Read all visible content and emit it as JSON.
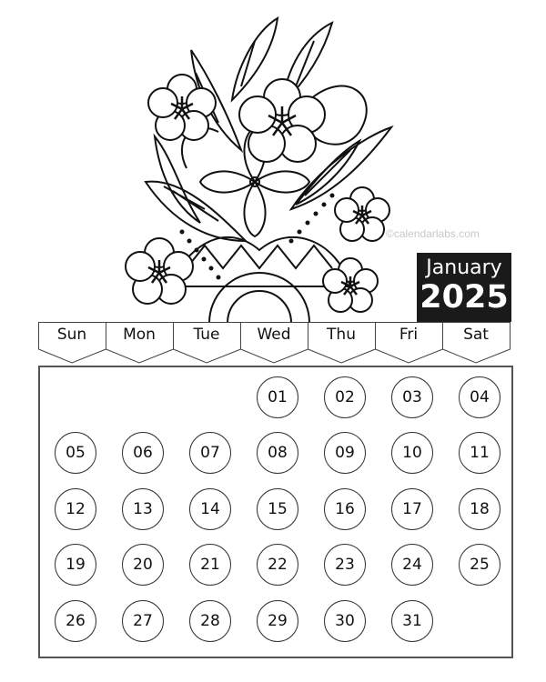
{
  "watermark": "©calendarlabs.com",
  "header": {
    "month": "January",
    "year": "2025"
  },
  "weekdays": [
    "Sun",
    "Mon",
    "Tue",
    "Wed",
    "Thu",
    "Fri",
    "Sat"
  ],
  "calendar": {
    "first_weekday_index": 3,
    "days": [
      "01",
      "02",
      "03",
      "04",
      "05",
      "06",
      "07",
      "08",
      "09",
      "10",
      "11",
      "12",
      "13",
      "14",
      "15",
      "16",
      "17",
      "18",
      "19",
      "20",
      "21",
      "22",
      "23",
      "24",
      "25",
      "26",
      "27",
      "28",
      "29",
      "30",
      "31"
    ]
  },
  "illustration": {
    "subject": "floral-mandala-coloring-art"
  }
}
